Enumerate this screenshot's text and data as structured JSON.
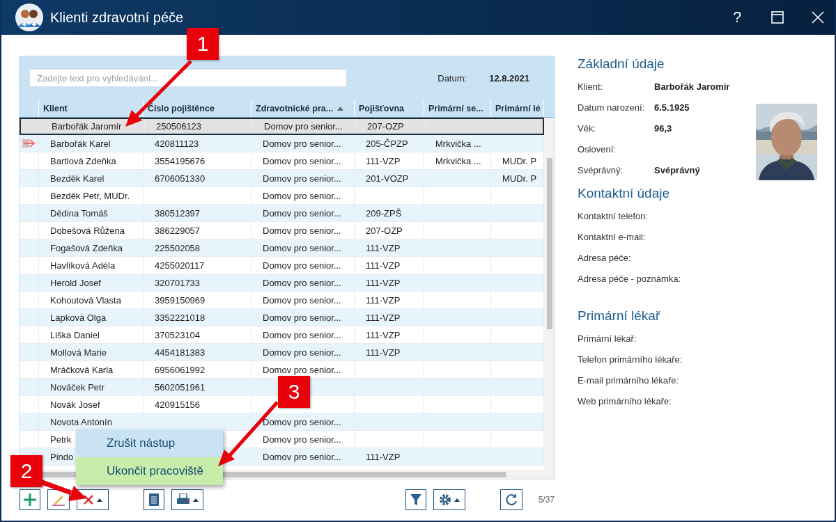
{
  "window": {
    "title": "Klienti zdravotní péče",
    "help": "?"
  },
  "search": {
    "placeholder": "Zadejte text pro vyhledávání..."
  },
  "date": {
    "label": "Datum:",
    "value": "12.8.2021"
  },
  "table": {
    "columns": [
      {
        "label": "Klient"
      },
      {
        "label": "Číslo pojištěnce"
      },
      {
        "label": "Zdravotnické pra...",
        "sorted": true
      },
      {
        "label": "Pojišťovna"
      },
      {
        "label": "Primární se..."
      },
      {
        "label": "Primární lé"
      }
    ],
    "rows": [
      {
        "selected": true,
        "current": false,
        "cells": [
          "Barbořák Jaromír",
          "250506123",
          "Domov pro senior...",
          "207-OZP",
          "",
          ""
        ]
      },
      {
        "selected": false,
        "current": true,
        "cells": [
          "Barbořák Karel",
          "420811123",
          "Domov pro senior...",
          "205-ČPZP",
          "Mrkvička ...",
          ""
        ]
      },
      {
        "selected": false,
        "current": false,
        "cells": [
          "Bartlová Zdeňka",
          "3554195676",
          "Domov pro senior...",
          "111-VZP",
          "Mrkvička ...",
          "MUDr. P"
        ]
      },
      {
        "selected": false,
        "current": false,
        "cells": [
          "Bezděk Karel",
          "6706051330",
          "Domov pro senior...",
          "201-VOZP",
          "",
          "MUDr. P"
        ]
      },
      {
        "selected": false,
        "current": false,
        "cells": [
          "Bezděk Petr, MUDr.",
          "",
          "Domov pro senior...",
          "",
          "",
          ""
        ]
      },
      {
        "selected": false,
        "current": false,
        "cells": [
          "Dědina Tomáš",
          "380512397",
          "Domov pro senior...",
          "209-ZPŠ",
          "",
          ""
        ]
      },
      {
        "selected": false,
        "current": false,
        "cells": [
          "Dobešová Růžena",
          "386229057",
          "Domov pro senior...",
          "207-OZP",
          "",
          ""
        ]
      },
      {
        "selected": false,
        "current": false,
        "cells": [
          "Fogašová Zdeňka",
          "225502058",
          "Domov pro senior...",
          "111-VZP",
          "",
          ""
        ]
      },
      {
        "selected": false,
        "current": false,
        "cells": [
          "Havlíková Adéla",
          "4255020117",
          "Domov pro senior...",
          "111-VZP",
          "",
          ""
        ]
      },
      {
        "selected": false,
        "current": false,
        "cells": [
          "Herold Josef",
          "320701733",
          "Domov pro senior...",
          "111-VZP",
          "",
          ""
        ]
      },
      {
        "selected": false,
        "current": false,
        "cells": [
          "Kohoutová Vlasta",
          "3959150969",
          "Domov pro senior...",
          "111-VZP",
          "",
          ""
        ]
      },
      {
        "selected": false,
        "current": false,
        "cells": [
          "Lapková Olga",
          "3352221018",
          "Domov pro senior...",
          "111-VZP",
          "",
          ""
        ]
      },
      {
        "selected": false,
        "current": false,
        "cells": [
          "Liška Daniel",
          "370523104",
          "Domov pro senior...",
          "111-VZP",
          "",
          ""
        ]
      },
      {
        "selected": false,
        "current": false,
        "cells": [
          "Mollová Marie",
          "4454181383",
          "Domov pro senior...",
          "111-VZP",
          "",
          ""
        ]
      },
      {
        "selected": false,
        "current": false,
        "cells": [
          "Mráčková Karla",
          "6956061992",
          "Domov pro senior...",
          "",
          "",
          ""
        ]
      },
      {
        "selected": false,
        "current": false,
        "cells": [
          "Nováček Petr",
          "5602051961",
          "",
          "",
          "",
          ""
        ]
      },
      {
        "selected": false,
        "current": false,
        "cells": [
          "Novák Josef",
          "420915156",
          "",
          "",
          "",
          ""
        ]
      },
      {
        "selected": false,
        "current": false,
        "cells": [
          "Novota Antonín",
          "",
          "Domov pro senior...",
          "",
          "",
          ""
        ]
      },
      {
        "selected": false,
        "current": false,
        "cells": [
          "Petrk",
          "",
          "Domov pro senior...",
          "",
          "",
          ""
        ]
      },
      {
        "selected": false,
        "current": false,
        "cells": [
          "Pindo",
          "",
          "Domov pro senior...",
          "111-VZP",
          "",
          ""
        ]
      }
    ]
  },
  "menu": {
    "items": [
      {
        "label": "Zrušit nástup",
        "selected": false
      },
      {
        "label": "Ukončit pracoviště",
        "selected": true
      }
    ]
  },
  "toolbar": {
    "count": "5/37"
  },
  "details": {
    "sections": [
      {
        "title": "Základní údaje",
        "fields": [
          {
            "label": "Klient:",
            "value": "Barbořák Jaromír"
          },
          {
            "label": "Datum narození:",
            "value": "6.5.1925"
          },
          {
            "label": "Věk:",
            "value": "96,3"
          },
          {
            "label": "Oslovení:"
          },
          {
            "label": "Svéprávný:",
            "value": "Svéprávný"
          }
        ]
      },
      {
        "title": "Kontaktní údaje",
        "fields": [
          {
            "label": "Kontaktní telefon:"
          },
          {
            "label": "Kontaktní e-mail:"
          },
          {
            "label": "Adresa péče:"
          },
          {
            "label": "Adresa péče - poznámka:"
          }
        ]
      },
      {
        "title": "Primární lékař",
        "fields": [
          {
            "label": "Primární lékař:"
          },
          {
            "label": "Telefon primárního lékaře:"
          },
          {
            "label": "E-mail primárního lékaře:"
          },
          {
            "label": "Web primárního lékaře:"
          }
        ]
      }
    ]
  },
  "callouts": [
    {
      "number": "1"
    },
    {
      "number": "2"
    },
    {
      "number": "3"
    }
  ]
}
